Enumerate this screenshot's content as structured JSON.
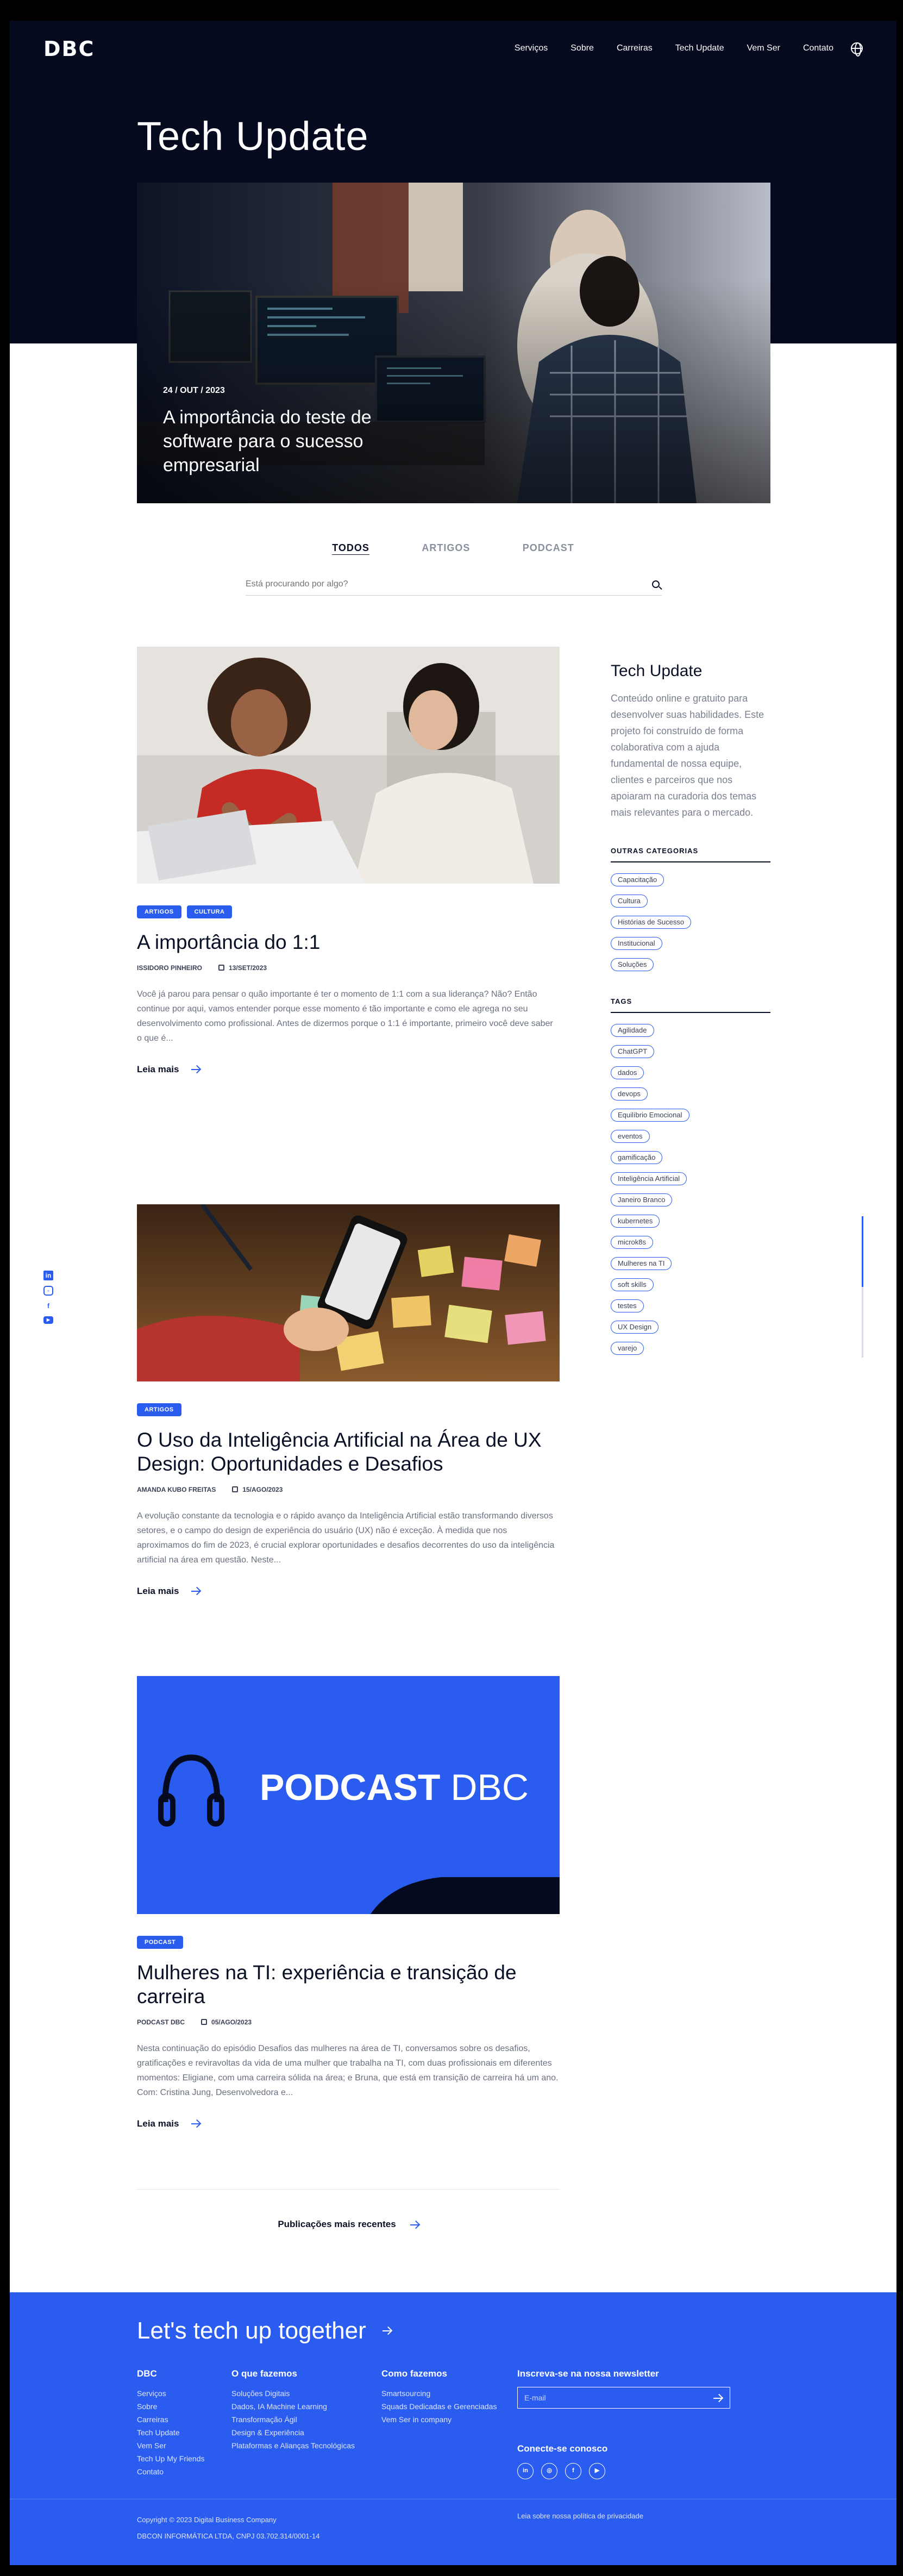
{
  "header": {
    "logo": "DBC",
    "nav": [
      "Serviços",
      "Sobre",
      "Carreiras",
      "Tech Update",
      "Vem Ser",
      "Contato"
    ]
  },
  "page_title": "Tech Update",
  "hero": {
    "date": "24 / OUT / 2023",
    "title": "A importância do teste de software para o sucesso empresarial"
  },
  "filters": [
    "TODOS",
    "ARTIGOS",
    "PODCAST"
  ],
  "search": {
    "placeholder": "Está procurando por algo?"
  },
  "posts": [
    {
      "badges": [
        "ARTIGOS",
        "CULTURA"
      ],
      "title": "A importância do 1:1",
      "author": "ISSIDORO PINHEIRO",
      "date": "13/SET/2023",
      "excerpt": "Você já parou para pensar o quão importante é ter o momento de 1:1 com a sua liderança? Não? Então continue por aqui, vamos entender porque esse momento é tão importante e como ele agrega no seu desenvolvimento como profissional. Antes de dizermos porque o 1:1 é importante, primeiro você deve saber o que é...",
      "more": "Leia mais"
    },
    {
      "badges": [
        "ARTIGOS"
      ],
      "title": "O Uso da Inteligência Artificial na Área de UX Design: Oportunidades e Desafios",
      "author": "AMANDA KUBO FREITAS",
      "date": "15/AGO/2023",
      "excerpt": "A evolução constante da tecnologia e o rápido avanço da Inteligência Artificial estão transformando diversos setores, e o campo do design de experiência do usuário (UX) não é exceção. À medida que nos aproximamos do fim de 2023, é crucial explorar oportunidades e desafios decorrentes do uso da inteligência artificial na área em questão. Neste...",
      "more": "Leia mais"
    },
    {
      "badges": [
        "PODCAST"
      ],
      "title": "Mulheres na TI: experiência e transição de carreira",
      "author": "PODCAST DBC",
      "date": "05/AGO/2023",
      "excerpt": "Nesta continuação do episódio Desafios das mulheres na área de TI, conversamos sobre os desafios, gratificações e reviravoltas da vida de uma mulher que trabalha na TI, com duas profissionais em diferentes momentos: Eligiane, com uma carreira sólida na área; e Bruna, que está em transição de carreira há um ano. Com: Cristina Jung, Desenvolvedora e...",
      "more": "Leia mais",
      "cover_text_bold": "PODCAST",
      "cover_text_light": "DBC"
    }
  ],
  "sidebar": {
    "title": "Tech Update",
    "description": "Conteúdo online e gratuito para desenvolver suas habilidades. Este projeto foi construído de forma colaborativa com a ajuda fundamental de nossa equipe, clientes e parceiros que nos apoiaram na curadoria dos temas mais relevantes para o mercado.",
    "categories_heading": "OUTRAS CATEGORIAS",
    "categories": [
      "Capacitação",
      "Cultura",
      "Histórias de Sucesso",
      "Institucional",
      "Soluções"
    ],
    "tags_heading": "TAGS",
    "tags": [
      "Agilidade",
      "ChatGPT",
      "dados",
      "devops",
      "Equilíbrio Emocional",
      "eventos",
      "gamificação",
      "Inteligência Artificial",
      "Janeiro Branco",
      "kubernetes",
      "microk8s",
      "Mulheres na TI",
      "soft skills",
      "testes",
      "UX Design",
      "varejo"
    ]
  },
  "pager": {
    "label": "Publicações mais recentes"
  },
  "footer": {
    "cta": "Let's tech up together",
    "col1": {
      "title": "DBC",
      "links": [
        "Serviços",
        "Sobre",
        "Carreiras",
        "Tech Update",
        "Vem Ser",
        "Tech Up My Friends",
        "Contato"
      ]
    },
    "col2": {
      "title": "O que fazemos",
      "links": [
        "Soluções Digitais",
        "Dados, IA Machine Learning",
        "Transformação Ágil",
        "Design & Experiência",
        "Plataformas e Alianças Tecnológicas"
      ]
    },
    "col3": {
      "title": "Como fazemos",
      "links": [
        "Smartsourcing",
        "Squads Dedicadas e Gerenciadas",
        "Vem Ser in company"
      ]
    },
    "newsletter": {
      "title": "Inscreva-se na nossa newsletter",
      "placeholder": "E-mail"
    },
    "connect": "Conecte-se conosco",
    "copyright": "Copyright © 2023 Digital Business Company",
    "company": "DBCON INFORMÁTICA LTDA, CNPJ 03.702.314/0001-14",
    "privacy": "Leia sobre nossa política de privacidade"
  },
  "colors": {
    "navy": "#050a1f",
    "accent": "#2b5cf0"
  }
}
